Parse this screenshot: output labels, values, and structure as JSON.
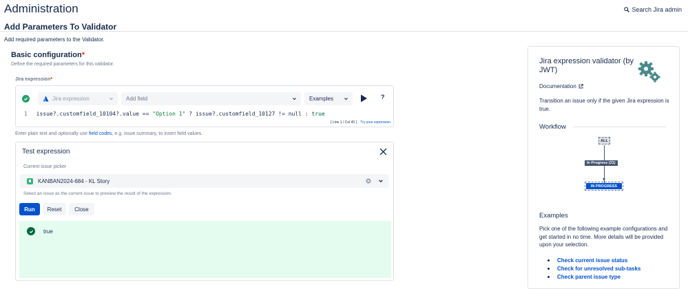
{
  "header": {
    "title": "Administration",
    "search_label": "Search Jira admin"
  },
  "page": {
    "subtitle": "Add Parameters To Validator",
    "description": "Add required parameters to the Validator."
  },
  "basic": {
    "title": "Basic configuration",
    "required_mark": "*",
    "description": "Define the required parameters for this validator.",
    "expr_label": "Jira expression",
    "expr_required_mark": "*"
  },
  "editor": {
    "language_select": "Jira expression",
    "field_select": "Add field",
    "examples_select": "Examples",
    "help_label": "?",
    "line_number": "1",
    "code": {
      "part1": "issue?.customfield_10104?.value == ",
      "string": "\"Option 1\"",
      "part2": " ? issue?.customfield_10127 != null : ",
      "kw": "true"
    },
    "status": "[ Line 1 / Col 45 ]",
    "try_link": "Try your expression"
  },
  "hint": {
    "before": "Enter plain text and optionally use ",
    "link": "field codes",
    "after": ", e.g. issue.summary, to insert field values."
  },
  "test": {
    "title": "Test expression",
    "picker_label": "Current issue picker",
    "picker_value": "KANBAN2024-684 - KL Story",
    "picker_hint": "Select an issue as the current issue to preview the result of the expression.",
    "run_label": "Run",
    "reset_label": "Reset",
    "close_label": "Close",
    "result": "true"
  },
  "sidebar": {
    "title": "Jira expression validator (by JWT)",
    "doc_label": "Documentation",
    "description": "Transition an issue only if the given Jira expression is true.",
    "workflow_heading": "Workflow",
    "workflow": {
      "from": "ALL",
      "transition": "In Progress (31)",
      "to": "IN PROGRESS"
    },
    "examples_heading": "Examples",
    "examples_desc": "Pick one of the following example configurations and get started in no time. More details will be provided upon your selection.",
    "examples": [
      "Check current issue status",
      "Check for unresolved sub-tasks",
      "Check parent issue type"
    ]
  },
  "colors": {
    "brand": "#0052cc",
    "success": "#22a06b",
    "success_bg": "#e3fcef",
    "text": "#172b4d",
    "muted": "#6b778c"
  }
}
